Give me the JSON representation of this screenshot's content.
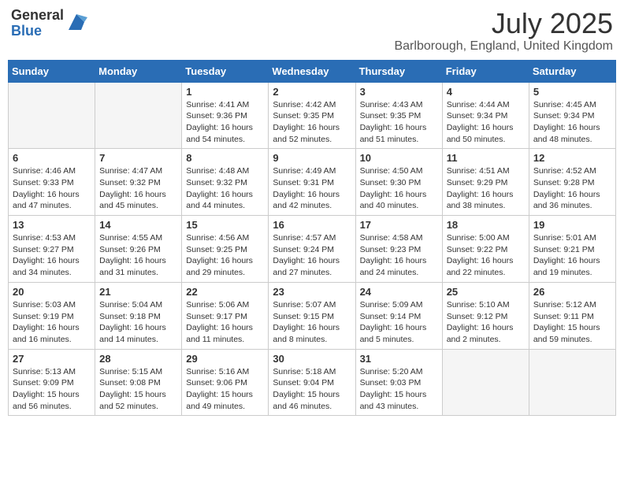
{
  "header": {
    "logo_general": "General",
    "logo_blue": "Blue",
    "month_title": "July 2025",
    "location": "Barlborough, England, United Kingdom"
  },
  "days_of_week": [
    "Sunday",
    "Monday",
    "Tuesday",
    "Wednesday",
    "Thursday",
    "Friday",
    "Saturday"
  ],
  "weeks": [
    [
      {
        "day": "",
        "info": ""
      },
      {
        "day": "",
        "info": ""
      },
      {
        "day": "1",
        "info": "Sunrise: 4:41 AM\nSunset: 9:36 PM\nDaylight: 16 hours\nand 54 minutes."
      },
      {
        "day": "2",
        "info": "Sunrise: 4:42 AM\nSunset: 9:35 PM\nDaylight: 16 hours\nand 52 minutes."
      },
      {
        "day": "3",
        "info": "Sunrise: 4:43 AM\nSunset: 9:35 PM\nDaylight: 16 hours\nand 51 minutes."
      },
      {
        "day": "4",
        "info": "Sunrise: 4:44 AM\nSunset: 9:34 PM\nDaylight: 16 hours\nand 50 minutes."
      },
      {
        "day": "5",
        "info": "Sunrise: 4:45 AM\nSunset: 9:34 PM\nDaylight: 16 hours\nand 48 minutes."
      }
    ],
    [
      {
        "day": "6",
        "info": "Sunrise: 4:46 AM\nSunset: 9:33 PM\nDaylight: 16 hours\nand 47 minutes."
      },
      {
        "day": "7",
        "info": "Sunrise: 4:47 AM\nSunset: 9:32 PM\nDaylight: 16 hours\nand 45 minutes."
      },
      {
        "day": "8",
        "info": "Sunrise: 4:48 AM\nSunset: 9:32 PM\nDaylight: 16 hours\nand 44 minutes."
      },
      {
        "day": "9",
        "info": "Sunrise: 4:49 AM\nSunset: 9:31 PM\nDaylight: 16 hours\nand 42 minutes."
      },
      {
        "day": "10",
        "info": "Sunrise: 4:50 AM\nSunset: 9:30 PM\nDaylight: 16 hours\nand 40 minutes."
      },
      {
        "day": "11",
        "info": "Sunrise: 4:51 AM\nSunset: 9:29 PM\nDaylight: 16 hours\nand 38 minutes."
      },
      {
        "day": "12",
        "info": "Sunrise: 4:52 AM\nSunset: 9:28 PM\nDaylight: 16 hours\nand 36 minutes."
      }
    ],
    [
      {
        "day": "13",
        "info": "Sunrise: 4:53 AM\nSunset: 9:27 PM\nDaylight: 16 hours\nand 34 minutes."
      },
      {
        "day": "14",
        "info": "Sunrise: 4:55 AM\nSunset: 9:26 PM\nDaylight: 16 hours\nand 31 minutes."
      },
      {
        "day": "15",
        "info": "Sunrise: 4:56 AM\nSunset: 9:25 PM\nDaylight: 16 hours\nand 29 minutes."
      },
      {
        "day": "16",
        "info": "Sunrise: 4:57 AM\nSunset: 9:24 PM\nDaylight: 16 hours\nand 27 minutes."
      },
      {
        "day": "17",
        "info": "Sunrise: 4:58 AM\nSunset: 9:23 PM\nDaylight: 16 hours\nand 24 minutes."
      },
      {
        "day": "18",
        "info": "Sunrise: 5:00 AM\nSunset: 9:22 PM\nDaylight: 16 hours\nand 22 minutes."
      },
      {
        "day": "19",
        "info": "Sunrise: 5:01 AM\nSunset: 9:21 PM\nDaylight: 16 hours\nand 19 minutes."
      }
    ],
    [
      {
        "day": "20",
        "info": "Sunrise: 5:03 AM\nSunset: 9:19 PM\nDaylight: 16 hours\nand 16 minutes."
      },
      {
        "day": "21",
        "info": "Sunrise: 5:04 AM\nSunset: 9:18 PM\nDaylight: 16 hours\nand 14 minutes."
      },
      {
        "day": "22",
        "info": "Sunrise: 5:06 AM\nSunset: 9:17 PM\nDaylight: 16 hours\nand 11 minutes."
      },
      {
        "day": "23",
        "info": "Sunrise: 5:07 AM\nSunset: 9:15 PM\nDaylight: 16 hours\nand 8 minutes."
      },
      {
        "day": "24",
        "info": "Sunrise: 5:09 AM\nSunset: 9:14 PM\nDaylight: 16 hours\nand 5 minutes."
      },
      {
        "day": "25",
        "info": "Sunrise: 5:10 AM\nSunset: 9:12 PM\nDaylight: 16 hours\nand 2 minutes."
      },
      {
        "day": "26",
        "info": "Sunrise: 5:12 AM\nSunset: 9:11 PM\nDaylight: 15 hours\nand 59 minutes."
      }
    ],
    [
      {
        "day": "27",
        "info": "Sunrise: 5:13 AM\nSunset: 9:09 PM\nDaylight: 15 hours\nand 56 minutes."
      },
      {
        "day": "28",
        "info": "Sunrise: 5:15 AM\nSunset: 9:08 PM\nDaylight: 15 hours\nand 52 minutes."
      },
      {
        "day": "29",
        "info": "Sunrise: 5:16 AM\nSunset: 9:06 PM\nDaylight: 15 hours\nand 49 minutes."
      },
      {
        "day": "30",
        "info": "Sunrise: 5:18 AM\nSunset: 9:04 PM\nDaylight: 15 hours\nand 46 minutes."
      },
      {
        "day": "31",
        "info": "Sunrise: 5:20 AM\nSunset: 9:03 PM\nDaylight: 15 hours\nand 43 minutes."
      },
      {
        "day": "",
        "info": ""
      },
      {
        "day": "",
        "info": ""
      }
    ]
  ]
}
